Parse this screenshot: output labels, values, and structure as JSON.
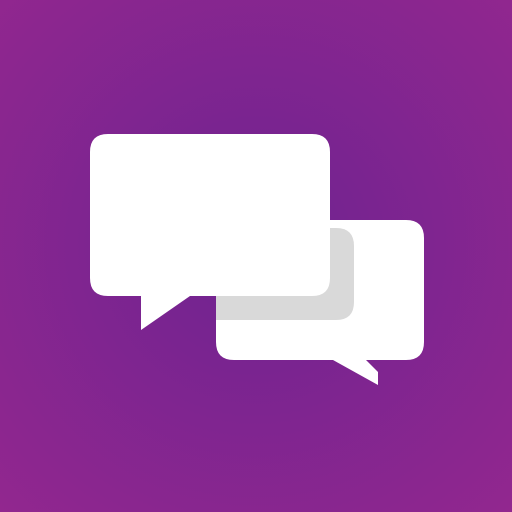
{
  "app_icon": {
    "icon": "chat-bubbles-icon",
    "colors": {
      "background_center": "#6E2390",
      "background_edge": "#92278F",
      "bubble_fill": "#FFFFFF",
      "bubble_shadow": "#D9D9D9"
    }
  }
}
